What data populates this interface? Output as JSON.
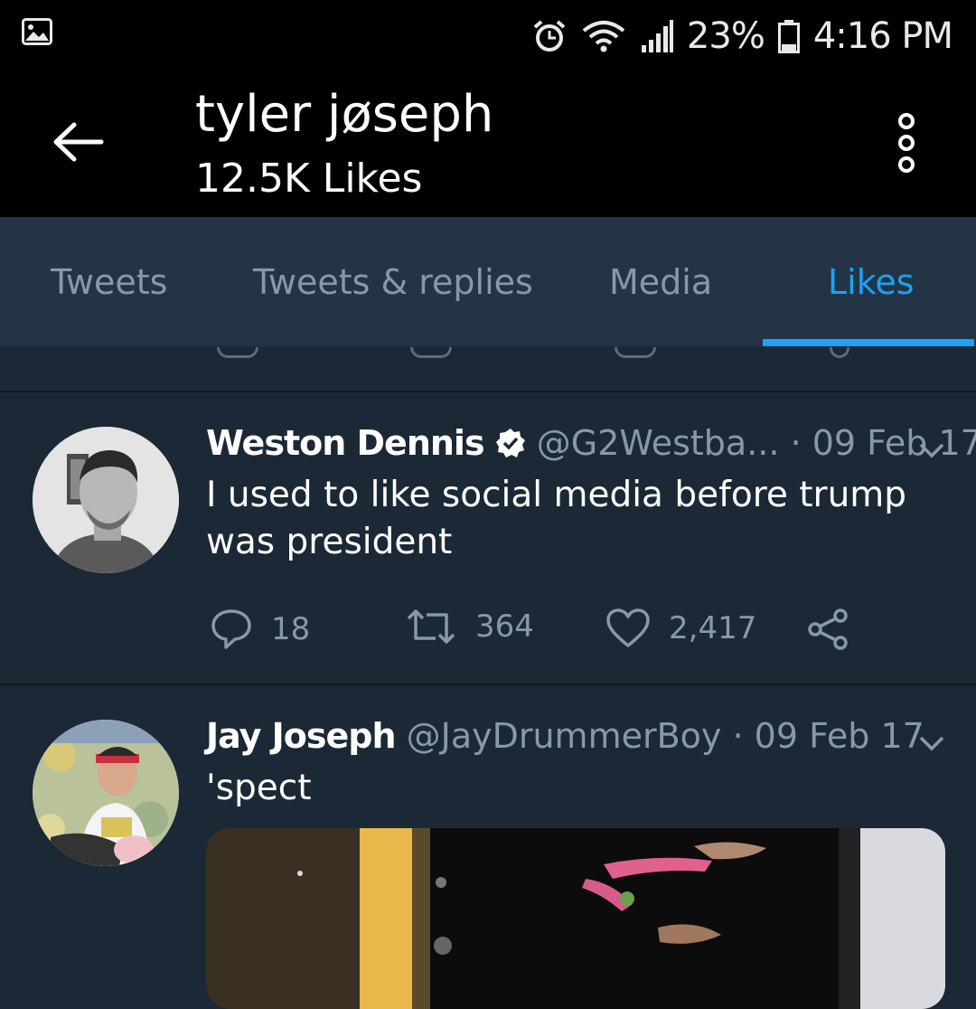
{
  "status_bar": {
    "battery": "23%",
    "time": "4:16 PM"
  },
  "header": {
    "title": "tyler jøseph",
    "subtitle": "12.5K Likes"
  },
  "tabs": [
    {
      "label": "Tweets",
      "active": false
    },
    {
      "label": "Tweets & replies",
      "active": false
    },
    {
      "label": "Media",
      "active": false
    },
    {
      "label": "Likes",
      "active": true
    }
  ],
  "tweets": [
    {
      "name": "Weston Dennis",
      "verified": true,
      "handle": "@G2Westba...",
      "date": "· 09 Feb 17",
      "text": "I used to like social media before trump was president",
      "replies": "18",
      "retweets": "364",
      "likes": "2,417"
    },
    {
      "name": "Jay Joseph",
      "verified": false,
      "handle": "@JayDrummerBoy",
      "date": "· 09 Feb 17",
      "text": "'spect"
    }
  ],
  "colors": {
    "accent": "#1da1f2",
    "background": "#1b2836",
    "tab_bar": "#243447",
    "muted": "#8899a6"
  }
}
